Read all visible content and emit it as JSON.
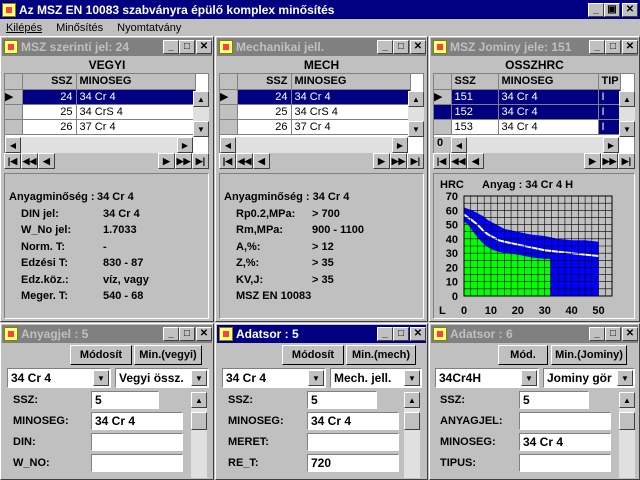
{
  "app": {
    "title": "Az MSZ EN 10083 szabványra épülő komplex minősítés",
    "menu": [
      "Kilépés",
      "Minősítés",
      "Nyomtatvány"
    ]
  },
  "win1": {
    "title": "MSZ szerinti jel: 24",
    "caption": "VEGYI",
    "col1": "SSZ",
    "col2": "MINOSEG",
    "rows": [
      [
        "24",
        "34 Cr 4"
      ],
      [
        "25",
        "34 CrS 4"
      ],
      [
        "26",
        "37 Cr 4"
      ]
    ],
    "info": [
      [
        "Anyagminőség :",
        "34 Cr 4"
      ],
      [
        "DIN jel:",
        "34 Cr 4"
      ],
      [
        "W_No jel:",
        "1.7033"
      ],
      [
        "Norm. T:",
        "-"
      ],
      [
        "Edzési T:",
        "830 -  87"
      ],
      [
        "Edz.köz.:",
        "víz, vagy"
      ],
      [
        "Meger. T:",
        "540 -  68"
      ]
    ]
  },
  "win2": {
    "title": "Mechanikai jell.",
    "caption": "MECH",
    "col1": "SSZ",
    "col2": "MINOSEG",
    "rows": [
      [
        "24",
        "34 Cr 4"
      ],
      [
        "25",
        "34 CrS 4"
      ],
      [
        "26",
        "37 Cr 4"
      ]
    ],
    "info_title": "Anyagminőség :  34 Cr 4",
    "info": [
      [
        "Rp0.2,MPa:",
        ">  700"
      ],
      [
        "Rm,MPa:",
        "900 -  1100"
      ],
      [
        "A,%:",
        ">  12"
      ],
      [
        "Z,%:",
        ">  35"
      ],
      [
        "KV,J:",
        ">  35"
      ]
    ],
    "footer": "MSZ EN 10083"
  },
  "win3": {
    "title": "MSZ Jominy jele: 151",
    "caption": "OSSZHRC",
    "col1": "SSZ",
    "col2": "MINOSEG",
    "col3": "TIP",
    "rows": [
      [
        "151",
        "34 Cr 4",
        "I"
      ],
      [
        "152",
        "34 Cr 4",
        "I"
      ],
      [
        "153",
        "34 Cr 4",
        "I"
      ]
    ],
    "scroll_value": "0",
    "chart_title": "Anyag : 34 Cr 4   H",
    "hrc_label": "HRC",
    "l_label": "L"
  },
  "chart_data": {
    "type": "area",
    "title": "Anyag : 34 Cr 4   H",
    "ylabel": "HRC",
    "xlabel": "L",
    "yticks": [
      "70",
      "60",
      "50",
      "40",
      "30",
      "20",
      "10",
      "0"
    ],
    "xticks": [
      "0",
      "10",
      "20",
      "30",
      "40",
      "50"
    ],
    "ylim": [
      0,
      70
    ],
    "xlim": [
      0,
      55
    ],
    "x": [
      0,
      1.5,
      3,
      5,
      7,
      9,
      11,
      13,
      15,
      20,
      25,
      30,
      35,
      40,
      45,
      50
    ],
    "series": [
      {
        "name": "",
        "color": "#0000ff",
        "values": [
          62,
          61,
          60,
          58,
          56,
          53,
          51,
          49,
          47,
          45,
          43,
          42,
          40,
          39,
          39,
          38
        ]
      },
      {
        "name": "",
        "color": "#ffffff",
        "values": [
          57,
          55,
          53,
          50,
          46,
          43,
          41,
          39,
          38,
          36,
          34,
          32,
          31,
          30,
          29,
          28
        ]
      },
      {
        "name": "",
        "color": "#00ff00",
        "values": [
          52,
          50,
          46,
          41,
          37,
          34,
          32,
          31,
          30,
          29,
          27,
          26,
          0,
          0,
          0,
          0
        ]
      }
    ]
  },
  "win4": {
    "title": "Anyagjel :  5",
    "btn1": "Módosít",
    "btn2": "Min.(vegyi)",
    "combo1": "34 Cr 4",
    "combo2": "Vegyi össz.",
    "fields": [
      [
        "SSZ:",
        "5"
      ],
      [
        "MINOSEG:",
        "34 Cr 4"
      ],
      [
        "DIN:",
        ""
      ],
      [
        "W_NO:",
        ""
      ]
    ]
  },
  "win5": {
    "title": "Adatsor : 5",
    "btn1": "Módosít",
    "btn2": "Min.(mech)",
    "combo1": "34 Cr 4",
    "combo2": "Mech. jell.",
    "fields": [
      [
        "SSZ:",
        "5"
      ],
      [
        "MINOSEG:",
        "34 Cr 4"
      ],
      [
        "MERET:",
        ""
      ],
      [
        "RE_T:",
        "720"
      ]
    ]
  },
  "win6": {
    "title": "Adatsor : 6",
    "btn1": "Mód.",
    "btn2": "Min.(Jominy)",
    "combo1": "34Cr4H",
    "combo2": "Jominy gör",
    "fields": [
      [
        "SSZ:",
        "5"
      ],
      [
        "ANYAGJEL:",
        ""
      ],
      [
        "MINOSEG:",
        "34 Cr 4"
      ],
      [
        "TIPUS:",
        ""
      ]
    ]
  }
}
